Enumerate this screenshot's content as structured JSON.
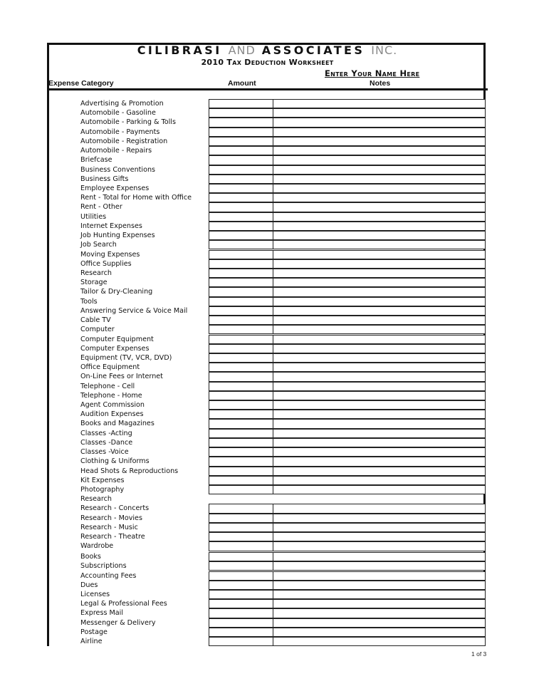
{
  "header": {
    "company_primary": "CILIBRASI",
    "company_and": "AND",
    "company_secondary": "ASSOCIATES",
    "company_suffix": "INC.",
    "worksheet_title": "2010 Tax Deduction Worksheet",
    "name_placeholder": "Enter Your Name Here"
  },
  "columns": {
    "category": "Expense Category",
    "amount": "Amount",
    "notes": "Notes"
  },
  "rows": [
    {
      "label": "Advertising & Promotion",
      "boxed": true
    },
    {
      "label": "Automobile - Gasoline",
      "boxed": true
    },
    {
      "label": "Automobile - Parking & Tolls",
      "boxed": true
    },
    {
      "label": "Automobile - Payments",
      "boxed": true
    },
    {
      "label": "Automobile - Registration",
      "boxed": true
    },
    {
      "label": "Automobile - Repairs",
      "boxed": true
    },
    {
      "label": "Briefcase",
      "boxed": true
    },
    {
      "label": "Business Conventions",
      "boxed": true
    },
    {
      "label": "Business Gifts",
      "boxed": true
    },
    {
      "label": "Employee Expenses",
      "boxed": true
    },
    {
      "label": "Rent - Total for Home with Office",
      "boxed": true
    },
    {
      "label": "Rent - Other",
      "boxed": true
    },
    {
      "label": "Utilities",
      "boxed": true
    },
    {
      "label": "Internet Expenses",
      "boxed": true
    },
    {
      "label": "Job Hunting Expenses",
      "boxed": true
    },
    {
      "label": "Job Search",
      "boxed": true
    },
    {
      "label": "Moving Expenses",
      "boxed": true
    },
    {
      "label": "Office Supplies",
      "boxed": true
    },
    {
      "label": "Research",
      "boxed": true
    },
    {
      "label": "Storage",
      "boxed": true
    },
    {
      "label": "Tailor & Dry-Cleaning",
      "boxed": true
    },
    {
      "label": "Tools",
      "boxed": true
    },
    {
      "label": "Answering Service & Voice Mail",
      "boxed": true
    },
    {
      "label": "Cable TV",
      "boxed": true
    },
    {
      "label": "Computer",
      "boxed": true
    },
    {
      "label": "Computer Equipment",
      "boxed": true
    },
    {
      "label": "Computer Expenses",
      "boxed": true
    },
    {
      "label": "Equipment (TV, VCR, DVD)",
      "boxed": true
    },
    {
      "label": "Office Equipment",
      "boxed": true
    },
    {
      "label": "On-Line Fees or Internet",
      "boxed": true
    },
    {
      "label": "Telephone - Cell",
      "boxed": true
    },
    {
      "label": "Telephone - Home",
      "boxed": true
    },
    {
      "label": "Agent Commission",
      "boxed": true
    },
    {
      "label": "Audition Expenses",
      "boxed": true
    },
    {
      "label": "Books and Magazines",
      "boxed": true
    },
    {
      "label": "Classes -Acting",
      "boxed": true
    },
    {
      "label": "Classes -Dance",
      "boxed": true
    },
    {
      "label": "Classes -Voice",
      "boxed": true
    },
    {
      "label": "Clothing & Uniforms",
      "boxed": true
    },
    {
      "label": "Head Shots & Reproductions",
      "boxed": true
    },
    {
      "label": "Kit Expenses",
      "boxed": true
    },
    {
      "label": "Photography",
      "boxed": true
    },
    {
      "label": "Research",
      "boxed": false
    },
    {
      "label": "Research - Concerts",
      "boxed": true
    },
    {
      "label": "Research - Movies",
      "boxed": true
    },
    {
      "label": "Research - Music",
      "boxed": true
    },
    {
      "label": "Research - Theatre",
      "boxed": true
    },
    {
      "label": "Wardrobe",
      "boxed": true
    },
    {
      "label": "Books",
      "boxed": true
    },
    {
      "label": "Subscriptions",
      "boxed": true
    },
    {
      "label": "Accounting Fees",
      "boxed": true
    },
    {
      "label": "Dues",
      "boxed": true
    },
    {
      "label": "Licenses",
      "boxed": true
    },
    {
      "label": "Legal & Professional Fees",
      "boxed": true
    },
    {
      "label": "Express Mail",
      "boxed": true
    },
    {
      "label": "Messenger & Delivery",
      "boxed": true
    },
    {
      "label": "Postage",
      "boxed": true
    },
    {
      "label": "Airline",
      "boxed": true
    }
  ],
  "footer": {
    "page_indicator": "1 of 3"
  }
}
